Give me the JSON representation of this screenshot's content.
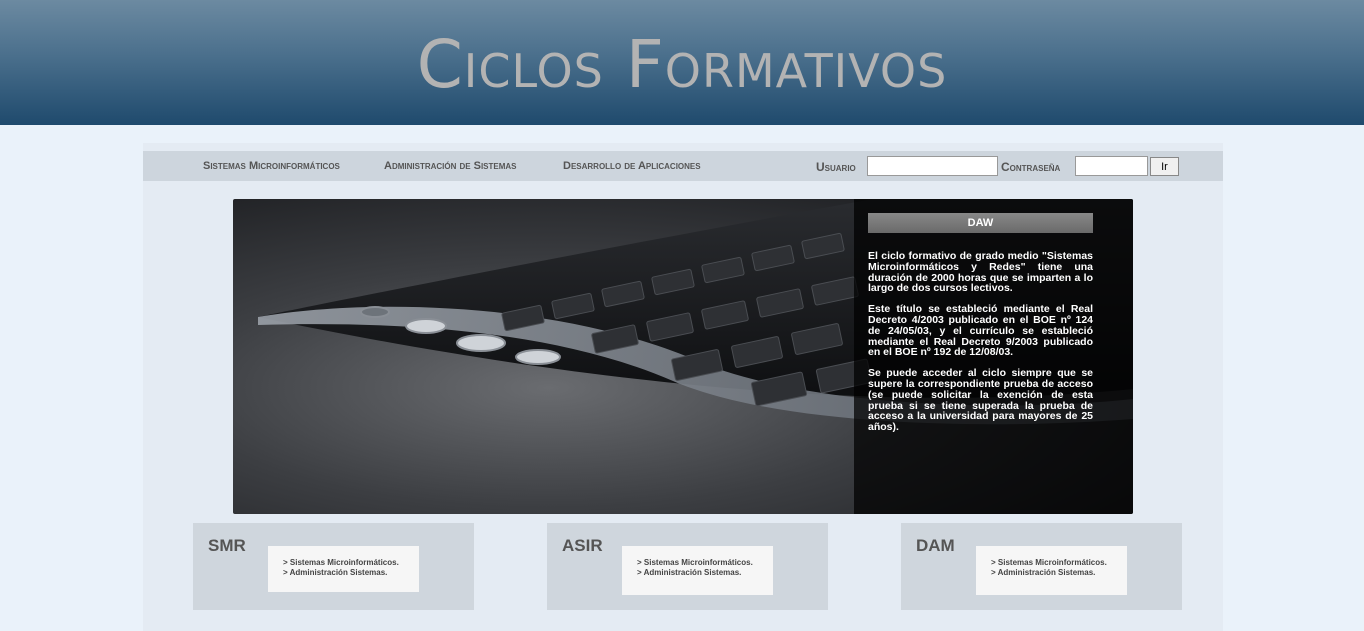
{
  "header": {
    "title": "Ciclos Formativos"
  },
  "nav": {
    "items": [
      "Sistemas Microinformáticos",
      "Administración de Sistemas",
      "Desarrollo de Aplicaciones"
    ]
  },
  "login": {
    "user_label": "Usuario",
    "password_label": "Contraseña",
    "user_value": "",
    "password_value": "",
    "submit_label": "Ir"
  },
  "hero": {
    "panel_title": "DAW",
    "paragraphs": [
      "El ciclo formativo de grado medio \"Sistemas Microinformáticos y Redes\" tiene una duración de 2000 horas que se imparten a lo largo de dos cursos lectivos.",
      "Este título se estableció mediante el Real Decreto 4/2003 publicado en el BOE nº 124 de 24/05/03, y el currículo se estableció mediante el Real Decreto 9/2003 publicado en el BOE nº 192 de 12/08/03.",
      "Se puede acceder al ciclo siempre que se supere la correspondiente prueba de acceso (se puede solicitar la exención de esta prueba si se tiene superada la prueba de acceso a la universidad para mayores de 25 años)."
    ]
  },
  "cards": [
    {
      "title": "SMR",
      "links": [
        "> Sistemas Microinformáticos.",
        "> Administración Sistemas."
      ]
    },
    {
      "title": "ASIR",
      "links": [
        "> Sistemas Microinformáticos.",
        "> Administración Sistemas."
      ]
    },
    {
      "title": "DAM",
      "links": [
        "> Sistemas Microinformáticos.",
        "> Administración Sistemas."
      ]
    }
  ]
}
